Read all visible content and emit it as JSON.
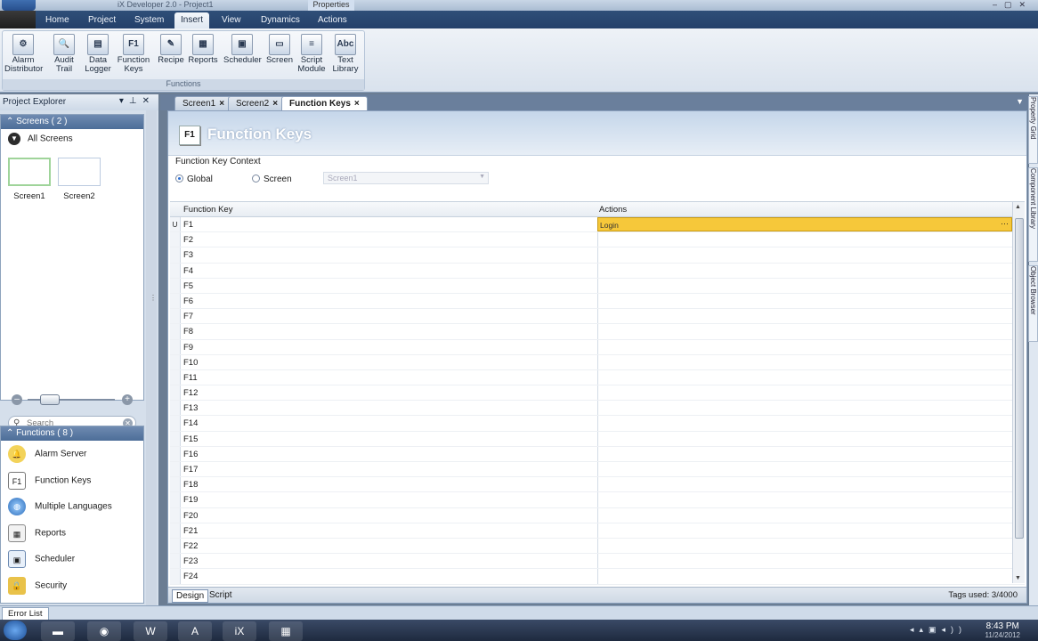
{
  "window": {
    "title": "iX Developer 2.0 - Project1",
    "properties_label": "Properties"
  },
  "ribbon": {
    "tabs": [
      {
        "label": "Home"
      },
      {
        "label": "Project"
      },
      {
        "label": "System"
      },
      {
        "label": "Insert"
      },
      {
        "label": "View"
      },
      {
        "label": "Dynamics"
      },
      {
        "label": "Actions"
      }
    ],
    "active_tab": "Insert",
    "group_label": "Functions",
    "buttons": [
      {
        "line1": "Alarm",
        "line2": "Distributor",
        "icon": "alarm-distributor-icon"
      },
      {
        "line1": "Audit",
        "line2": "Trail",
        "icon": "audit-trail-icon"
      },
      {
        "line1": "Data",
        "line2": "Logger",
        "icon": "data-logger-icon"
      },
      {
        "line1": "Function",
        "line2": "Keys",
        "icon": "function-keys-icon"
      },
      {
        "line1": "Recipe",
        "line2": "",
        "icon": "recipe-icon"
      },
      {
        "line1": "Reports",
        "line2": "",
        "icon": "reports-icon"
      },
      {
        "line1": "Scheduler",
        "line2": "",
        "icon": "scheduler-icon"
      },
      {
        "line1": "Screen",
        "line2": "",
        "icon": "screen-icon"
      },
      {
        "line1": "Script",
        "line2": "Module",
        "icon": "script-module-icon"
      },
      {
        "line1": "Text",
        "line2": "Library",
        "icon": "text-library-icon"
      }
    ]
  },
  "explorer": {
    "title": "Project Explorer",
    "screens_header": "Screens ( 2 )",
    "all_screens": "All Screens",
    "screens": [
      {
        "label": "Screen1"
      },
      {
        "label": "Screen2"
      }
    ],
    "search_placeholder": "Search",
    "functions_header": "Functions ( 8 )",
    "functions": [
      {
        "label": "Alarm Server",
        "icon": "bell-icon"
      },
      {
        "label": "Function Keys",
        "icon": "function-key-icon"
      },
      {
        "label": "Multiple Languages",
        "icon": "globe-icon"
      },
      {
        "label": "Reports",
        "icon": "report-icon"
      },
      {
        "label": "Scheduler",
        "icon": "calendar-icon"
      },
      {
        "label": "Security",
        "icon": "lock-icon"
      }
    ]
  },
  "doc_tabs": [
    {
      "label": "Screen1",
      "active": false
    },
    {
      "label": "Screen2",
      "active": false
    },
    {
      "label": "Function Keys",
      "active": true
    }
  ],
  "editor": {
    "icon_text": "F1",
    "title": "Function Keys",
    "context_label": "Function Key Context",
    "radio_global": "Global",
    "radio_screen": "Screen",
    "screen_select": "Screen1",
    "col_function_key": "Function Key",
    "col_actions": "Actions",
    "rows": [
      {
        "key": "F1",
        "action": "Login",
        "indicator": "U"
      },
      {
        "key": "F2",
        "action": ""
      },
      {
        "key": "F3",
        "action": ""
      },
      {
        "key": "F4",
        "action": ""
      },
      {
        "key": "F5",
        "action": ""
      },
      {
        "key": "F6",
        "action": ""
      },
      {
        "key": "F7",
        "action": ""
      },
      {
        "key": "F8",
        "action": ""
      },
      {
        "key": "F9",
        "action": ""
      },
      {
        "key": "F10",
        "action": ""
      },
      {
        "key": "F11",
        "action": ""
      },
      {
        "key": "F12",
        "action": ""
      },
      {
        "key": "F13",
        "action": ""
      },
      {
        "key": "F14",
        "action": ""
      },
      {
        "key": "F15",
        "action": ""
      },
      {
        "key": "F16",
        "action": ""
      },
      {
        "key": "F17",
        "action": ""
      },
      {
        "key": "F18",
        "action": ""
      },
      {
        "key": "F19",
        "action": ""
      },
      {
        "key": "F20",
        "action": ""
      },
      {
        "key": "F21",
        "action": ""
      },
      {
        "key": "F22",
        "action": ""
      },
      {
        "key": "F23",
        "action": ""
      },
      {
        "key": "F24",
        "action": ""
      }
    ],
    "footer_tabs": [
      {
        "label": "Design"
      },
      {
        "label": "Script"
      }
    ],
    "tags_used": "Tags used: 3/4000"
  },
  "right_panels": [
    {
      "label": "Property Grid"
    },
    {
      "label": "Component Library"
    },
    {
      "label": "Object Browser"
    }
  ],
  "bottom": {
    "error_list": "Error List"
  },
  "taskbar": {
    "time": "8:43 PM",
    "date": "11/24/2012",
    "apps": [
      "explorer-icon",
      "chrome-icon",
      "word-icon",
      "acrobat-icon",
      "ix-developer-icon",
      "calculator-icon"
    ]
  },
  "colors": {
    "selected_cell": "#f6c83a",
    "header_blue": "#4c6d98",
    "ribbon_dark": "#24406a"
  }
}
